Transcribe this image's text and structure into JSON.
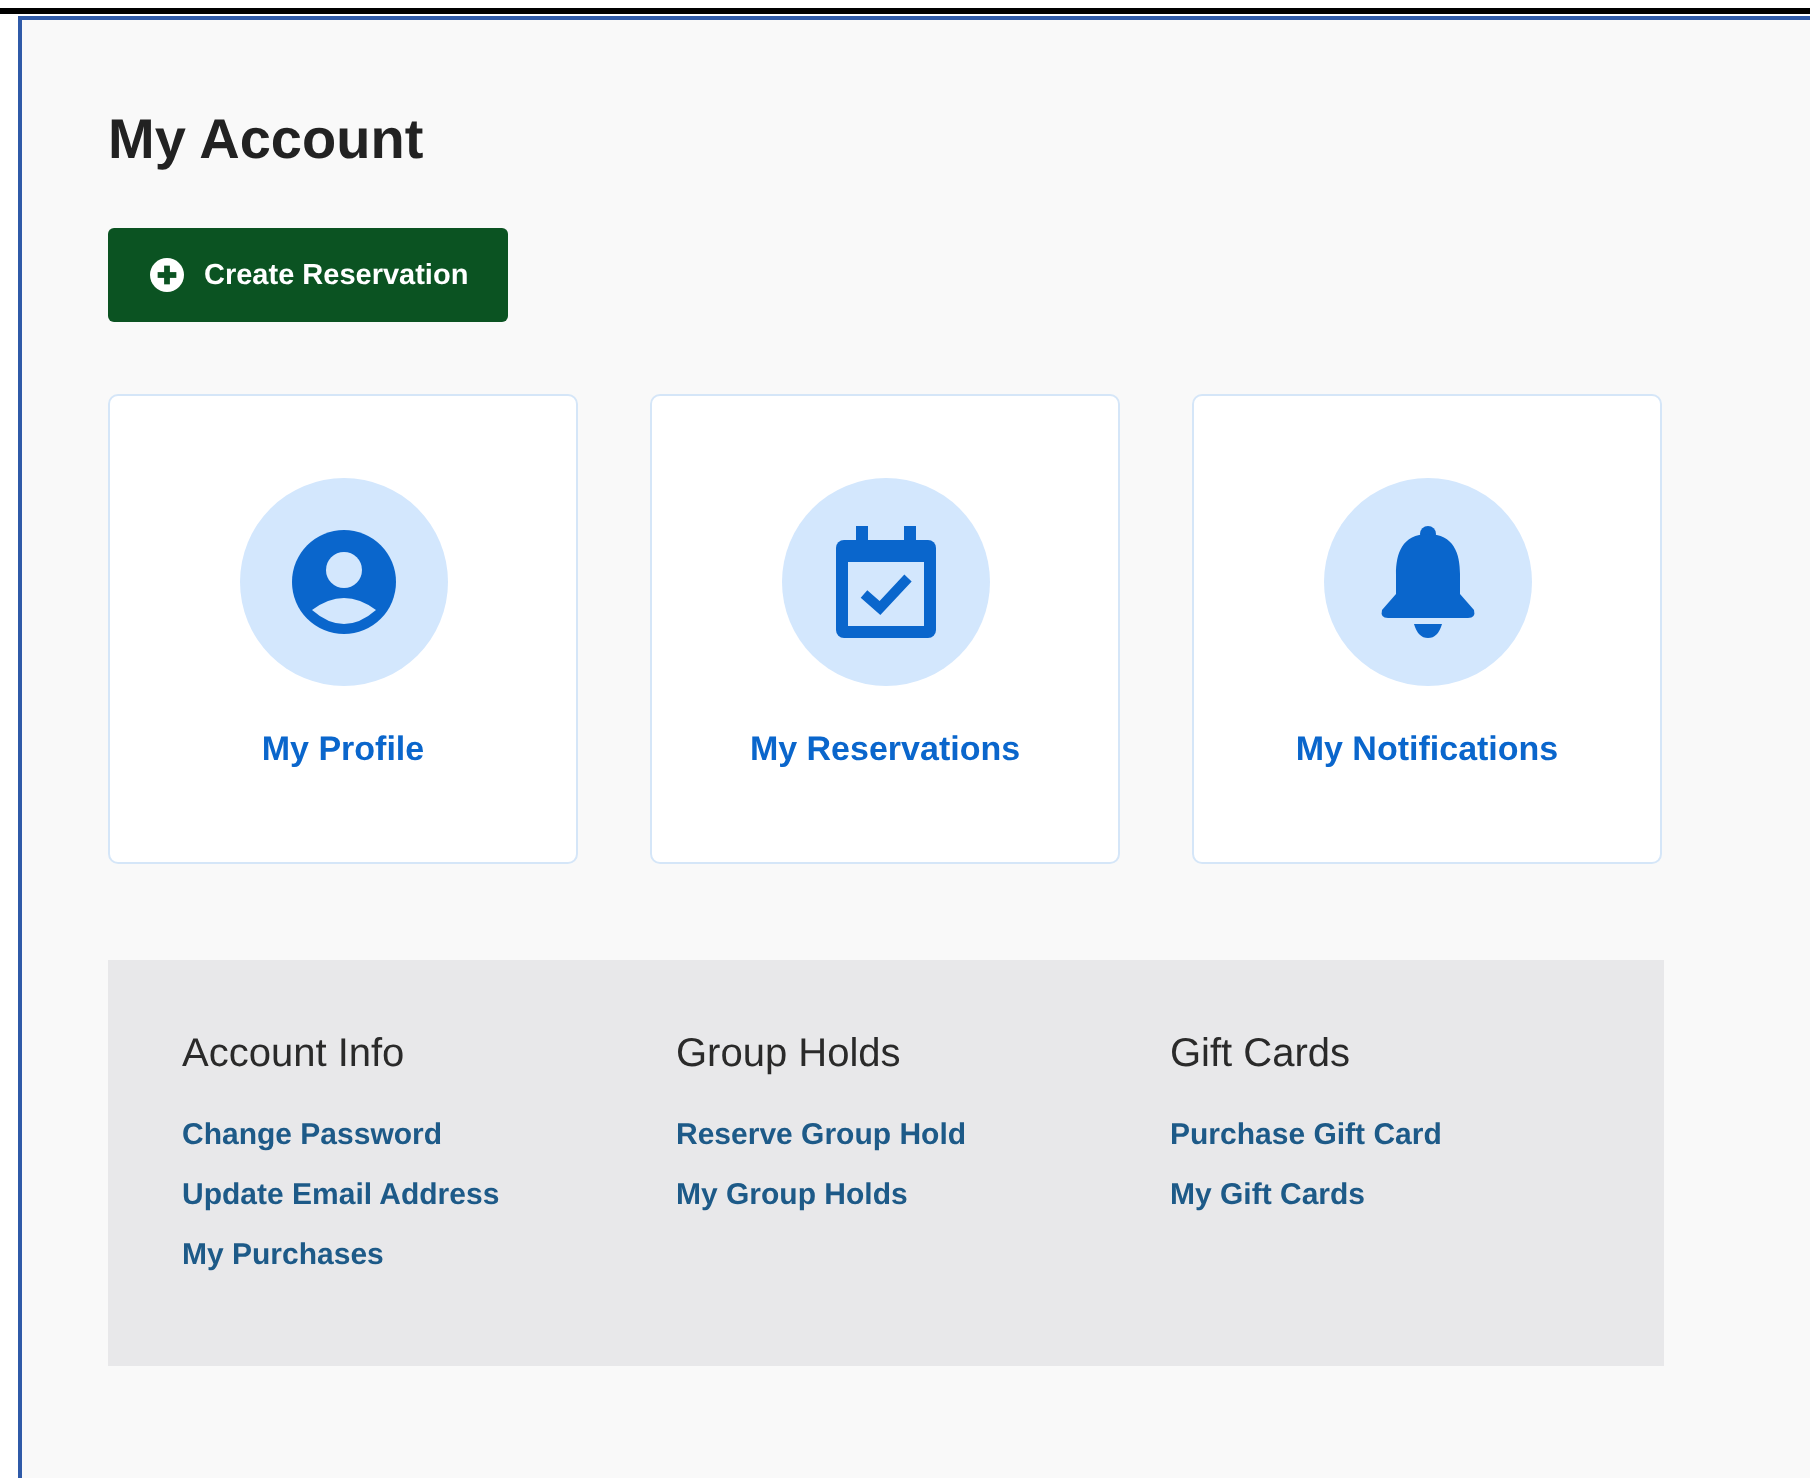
{
  "page": {
    "title": "My Account"
  },
  "create_button": {
    "label": "Create Reservation"
  },
  "cards": [
    {
      "kind": "profile",
      "label": "My Profile"
    },
    {
      "kind": "calendar",
      "label": "My Reservations"
    },
    {
      "kind": "bell",
      "label": "My Notifications"
    }
  ],
  "link_groups": [
    {
      "heading": "Account Info",
      "links": [
        "Change Password",
        "Update Email Address",
        "My Purchases"
      ]
    },
    {
      "heading": "Group Holds",
      "links": [
        "Reserve Group Hold",
        "My Group Holds"
      ]
    },
    {
      "heading": "Gift Cards",
      "links": [
        "Purchase Gift Card",
        "My Gift Cards"
      ]
    }
  ]
}
